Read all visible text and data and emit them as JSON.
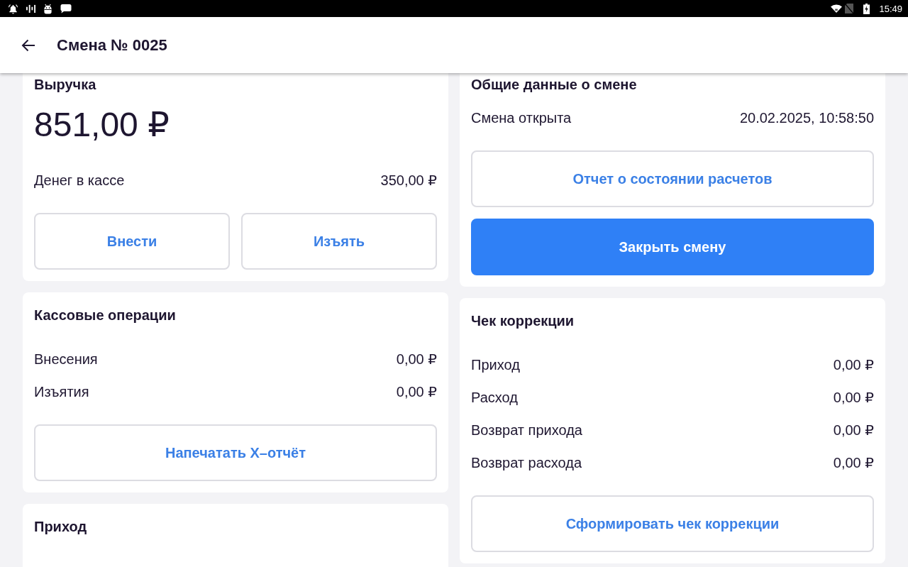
{
  "status_bar": {
    "time": "15:49"
  },
  "header": {
    "title": "Смена № 0025"
  },
  "columns": [
    {
      "cards": [
        {
          "title": "Выручка",
          "amount": "851,00 ₽",
          "rows": [
            {
              "label": "Денег в кассе",
              "value": "350,00 ₽"
            }
          ],
          "button_rows": [
            [
              {
                "label": "Внести",
                "kind": "outline"
              },
              {
                "label": "Изъять",
                "kind": "outline"
              }
            ]
          ]
        },
        {
          "title": "Кассовые операции",
          "rows": [
            {
              "label": "Внесения",
              "value": "0,00 ₽"
            },
            {
              "label": "Изъятия",
              "value": "0,00 ₽"
            }
          ],
          "button_rows": [
            [
              {
                "label": "Напечатать X–отчёт",
                "kind": "outline"
              }
            ]
          ]
        },
        {
          "title": "Приход"
        }
      ]
    },
    {
      "cards": [
        {
          "title": "Общие данные о смене",
          "rows": [
            {
              "label": "Смена открыта",
              "value": "20.02.2025, 10:58:50"
            }
          ],
          "button_rows": [
            [
              {
                "label": "Отчет о состоянии расчетов",
                "kind": "outline"
              }
            ],
            [
              {
                "label": "Закрыть смену",
                "kind": "primary"
              }
            ]
          ]
        },
        {
          "title": "Чек коррекции",
          "rows": [
            {
              "label": "Приход",
              "value": "0,00 ₽"
            },
            {
              "label": "Расход",
              "value": "0,00 ₽"
            },
            {
              "label": "Возврат прихода",
              "value": "0,00 ₽"
            },
            {
              "label": "Возврат расхода",
              "value": "0,00 ₽"
            }
          ],
          "button_rows": [
            [
              {
                "label": "Сформировать чек коррекции",
                "kind": "outline"
              }
            ]
          ]
        }
      ]
    }
  ]
}
